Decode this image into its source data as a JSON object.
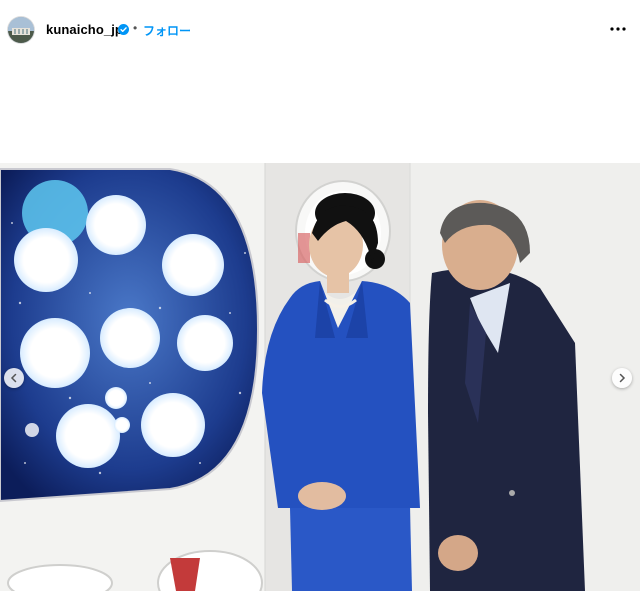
{
  "post": {
    "username": "kunaicho_jp",
    "separator": "•",
    "follow_label": "フォロー",
    "verified_icon": "verified-badge-icon",
    "more_icon": "more-options-icon",
    "verified_color": "#0095f6",
    "follow_color": "#0095f6"
  },
  "carousel": {
    "prev_icon": "chevron-left-icon",
    "next_icon": "chevron-right-icon"
  }
}
